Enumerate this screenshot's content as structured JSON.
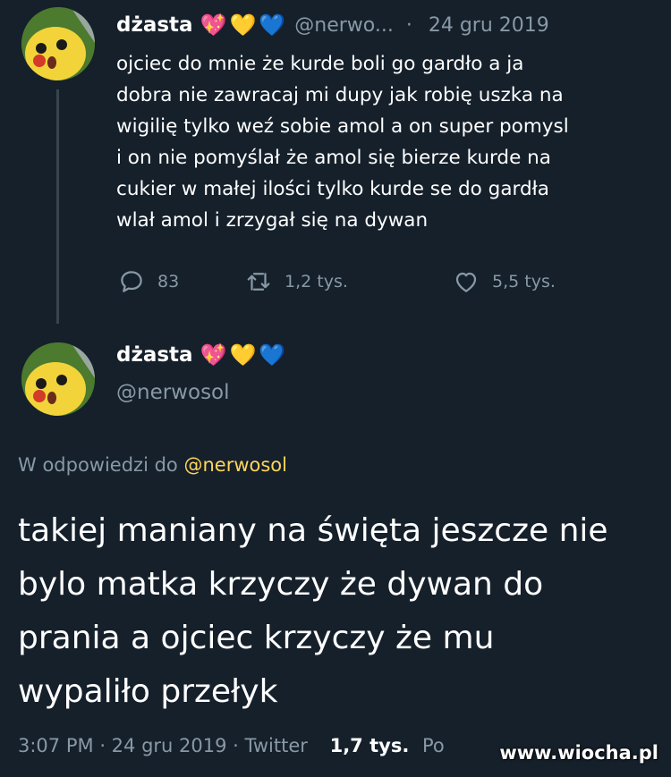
{
  "tweet1": {
    "display_name": "dżasta",
    "emojis": [
      "💖",
      "💛",
      "💙"
    ],
    "handle": "@nerwo...",
    "date_separator": "·",
    "date": "24 gru 2019",
    "text": "ojciec do mnie że kurde boli go gardło a ja\ndobra nie zawracaj mi dupy jak robię uszka na\nwigilię tylko weź sobie amol a on super pomysl\ni on nie pomyślał że amol się bierze kurde na\ncukier w małej ilości tylko kurde se do gardła\nwlał amol i zrzygał się na dywan",
    "reply_count": "83",
    "retweet_count": "1,2 tys.",
    "like_count": "5,5 tys.",
    "icons": {
      "reply": "speech-bubble-icon",
      "retweet": "retweet-arrows-icon",
      "like": "heart-icon"
    }
  },
  "tweet2": {
    "display_name": "dżasta",
    "emojis": [
      "💖",
      "💛",
      "💙"
    ],
    "handle": "@nerwosol",
    "reply_prefix": "W odpowiedzi do",
    "reply_handle": "@nerwosol",
    "text": "takiej maniany na święta jeszcze nie\nbylo matka krzyczy że dywan do\nprania a ojciec krzyczy że mu\nwypaliło przełyk",
    "time": "3:07 PM",
    "date": "24 gru 2019",
    "source": "Twitter",
    "likes_count": "1,7 tys.",
    "likes_label_partial": "Po"
  },
  "watermark": "www.wiocha.pl",
  "colors": {
    "background": "#15202b",
    "muted": "#8899a6",
    "reply_handle": "#ffd45e",
    "thread_line": "#38444d"
  }
}
